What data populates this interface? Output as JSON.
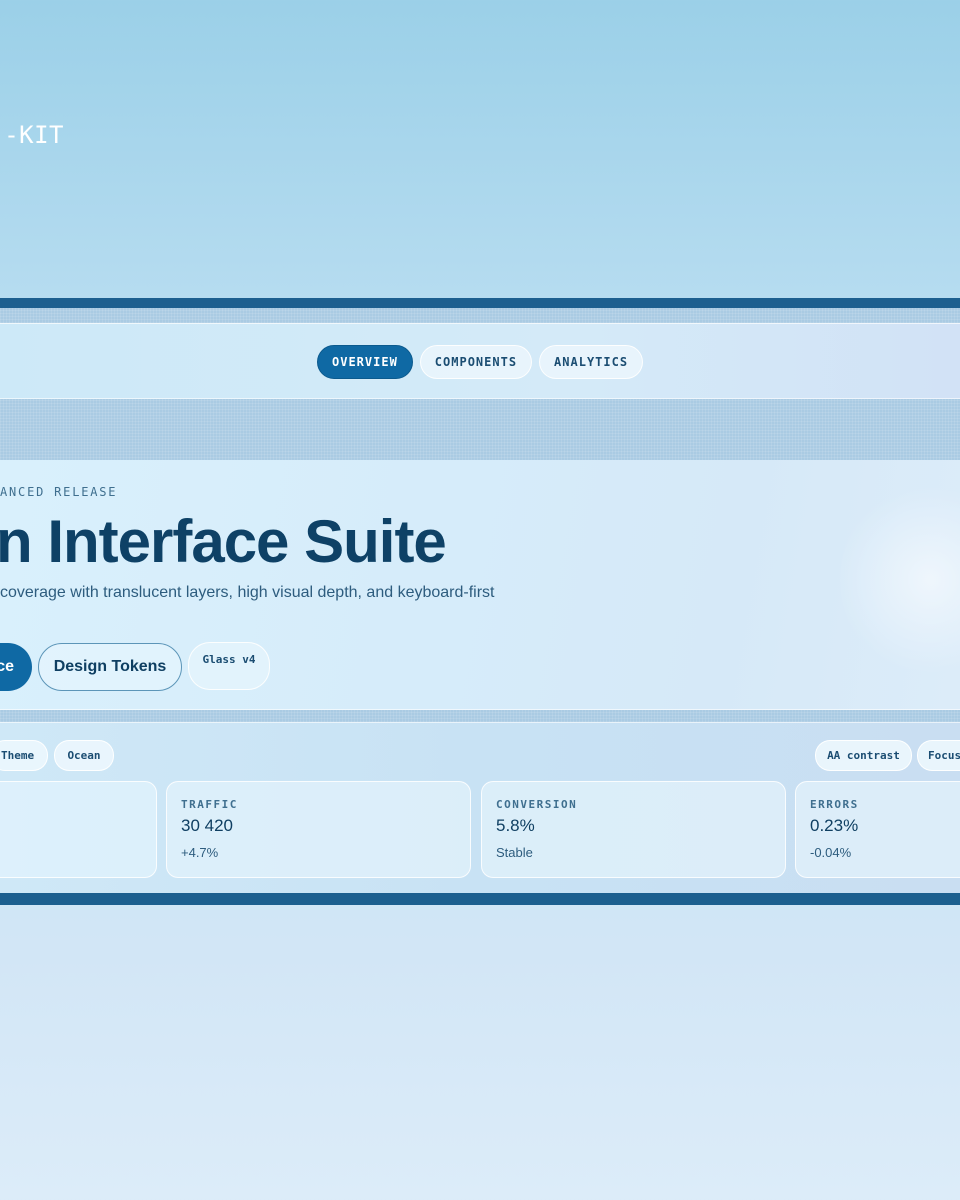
{
  "brand": {
    "text": "-KIT"
  },
  "nav": {
    "tabs": [
      {
        "label": "OVERVIEW",
        "active": true
      },
      {
        "label": "COMPONENTS",
        "active": false
      },
      {
        "label": "ANALYTICS",
        "active": false
      }
    ]
  },
  "hero": {
    "eyebrow": "ANCED RELEASE",
    "title": "n Interface Suite",
    "subtitle": "coverage with translucent layers, high visual depth, and keyboard-first",
    "primary_button": "ce",
    "secondary_button": "Design Tokens",
    "version_chip": "Glass v4"
  },
  "chips": {
    "left": [
      "Theme",
      "Ocean"
    ],
    "right": [
      "AA contrast",
      "Focus"
    ]
  },
  "cards": [
    {
      "label": "",
      "value": "",
      "delta": ""
    },
    {
      "label": "TRAFFIC",
      "value": "30 420",
      "delta": "+4.7%"
    },
    {
      "label": "CONVERSION",
      "value": "5.8%",
      "delta": "Stable"
    },
    {
      "label": "ERRORS",
      "value": "0.23%",
      "delta": "-0.04%"
    }
  ],
  "colors": {
    "accent": "#0f69a4",
    "frame_bar": "#1c5f8f",
    "text": "#0f3f62",
    "background": "#9bd0e8"
  }
}
